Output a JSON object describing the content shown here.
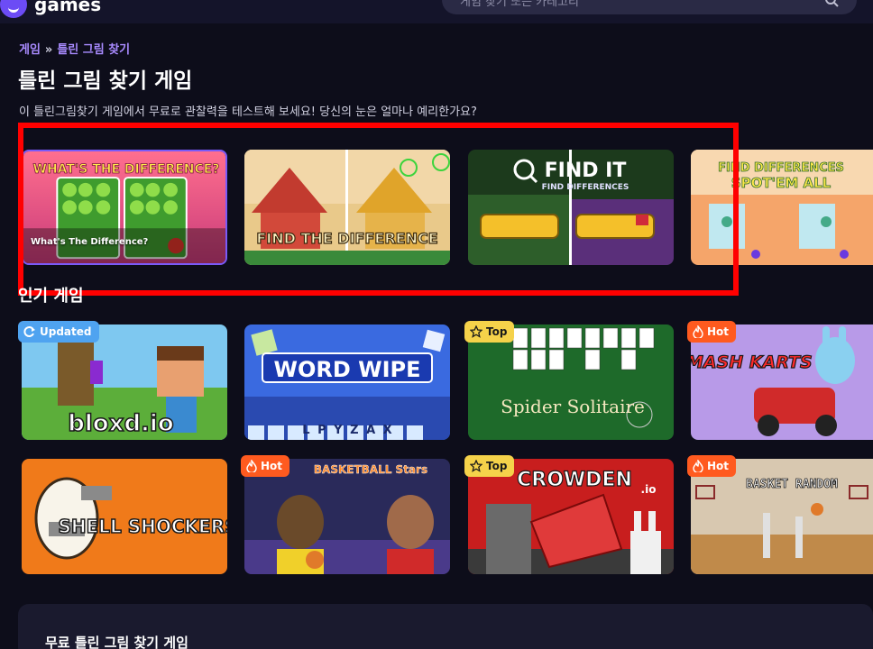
{
  "header": {
    "logo_text": "games",
    "search_placeholder": "게임 찾기 또는 카테고리"
  },
  "breadcrumb": {
    "home": "게임",
    "separator": "»",
    "current": "틀린 그림 찾기"
  },
  "page": {
    "title": "틀린 그림 찾기 게임",
    "description": "이 틀린그림찾기 게임에서 무료로 관찰력을 테스트해 보세요! 당신의 눈은 얼마나 예리한가요?"
  },
  "featured_games": [
    {
      "title": "WHAT'S THE DIFFERENCE?",
      "hover_label": "What's The Difference?"
    },
    {
      "title": "FIND THE DIFFERENCE"
    },
    {
      "title": "FIND IT",
      "subtitle": "FIND DIFFERENCES"
    },
    {
      "title": "FIND DIFFERENCES",
      "subtitle": "SPOT'EM ALL"
    }
  ],
  "popular_section": {
    "title": "인기 게임"
  },
  "popular_games": [
    {
      "title": "bloxd.io",
      "badge": "Updated"
    },
    {
      "title": "WORD WIPE",
      "letters": [
        "L",
        "P",
        "Y",
        "Z",
        "A",
        "X"
      ]
    },
    {
      "title": "Spider Solitaire",
      "badge": "Top"
    },
    {
      "title": "SMASH KARTS",
      "badge": "Hot"
    },
    {
      "title": "SHELL SHOCKERS"
    },
    {
      "title": "BASKETBALL Stars",
      "badge": "Hot"
    },
    {
      "title": "CROWDEN",
      "suffix": ".io",
      "badge": "Top"
    },
    {
      "title": "BASKET RANDOM",
      "badge": "Hot"
    }
  ],
  "footer": {
    "title": "무료 틀린 그림 찾기 게임"
  },
  "colors": {
    "background": "#0d0d1a",
    "accent": "#7a5af8",
    "breadcrumb": "#a98bff",
    "highlight": "#ff0000",
    "badge_updated": "#4fa3f0",
    "badge_top": "#f5d24a",
    "badge_hot": "#ff5a1f"
  }
}
